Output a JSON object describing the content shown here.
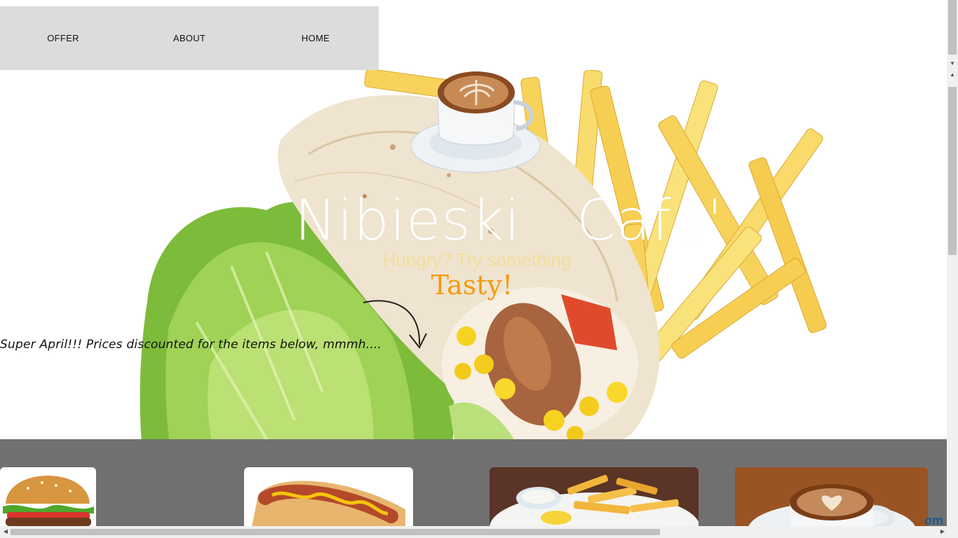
{
  "nav": {
    "items": [
      {
        "label": "OFFER"
      },
      {
        "label": "ABOUT"
      },
      {
        "label": "HOME"
      }
    ]
  },
  "hero": {
    "brand_title": "Nibieski   Cafe'",
    "tagline": "Hungry? Try something",
    "tagline_accent": "Tasty!",
    "promo_text": "Super April!!! Prices discounted for the items below, mmmh....",
    "image": "wrap-fries-lettuce-photo"
  },
  "products": [
    {
      "icon": "burger-photo"
    },
    {
      "icon": "hotdog-photo"
    },
    {
      "icon": "fries-plate-photo"
    },
    {
      "icon": "latte-photo"
    }
  ],
  "footer_fragment": "om",
  "colors": {
    "nav_bg": "#dcdcdc",
    "band_bg": "#505050",
    "tagline": "#f1de9b",
    "accent": "#f59a11"
  }
}
